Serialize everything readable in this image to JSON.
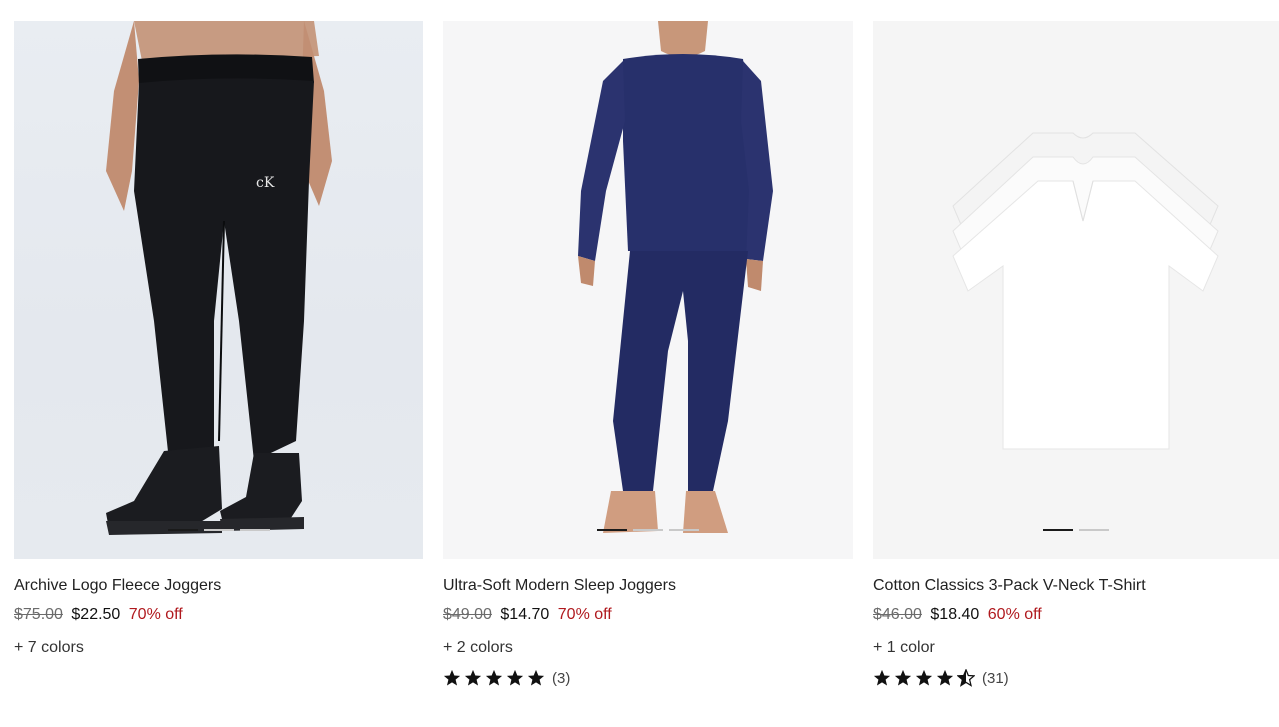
{
  "products": [
    {
      "title": "Archive Logo Fleece Joggers",
      "original_price": "$75.00",
      "sale_price": "$22.50",
      "discount": "70% off",
      "colors": "+ 7 colors",
      "image_icon": "black-fleece-joggers-image",
      "carousel": {
        "count": 3,
        "active": 0
      }
    },
    {
      "title": "Ultra-Soft Modern Sleep Joggers",
      "original_price": "$49.00",
      "sale_price": "$14.70",
      "discount": "70% off",
      "colors": "+ 2 colors",
      "image_icon": "navy-sleep-set-image",
      "carousel": {
        "count": 3,
        "active": 0
      },
      "rating": {
        "stars": 5,
        "count": "(3)"
      }
    },
    {
      "title": "Cotton Classics 3-Pack V-Neck T-Shirt",
      "original_price": "$46.00",
      "sale_price": "$18.40",
      "discount": "60% off",
      "colors": "+ 1 color",
      "image_icon": "white-tshirt-pack-image",
      "carousel": {
        "count": 2,
        "active": 0
      },
      "rating": {
        "stars": 4.5,
        "count": "(31)"
      }
    }
  ],
  "colors": {
    "discount_red": "#b0191e",
    "text": "#1a1a1a",
    "muted": "#6b6b6b",
    "navy": "#27306b",
    "black_garment": "#141518"
  }
}
